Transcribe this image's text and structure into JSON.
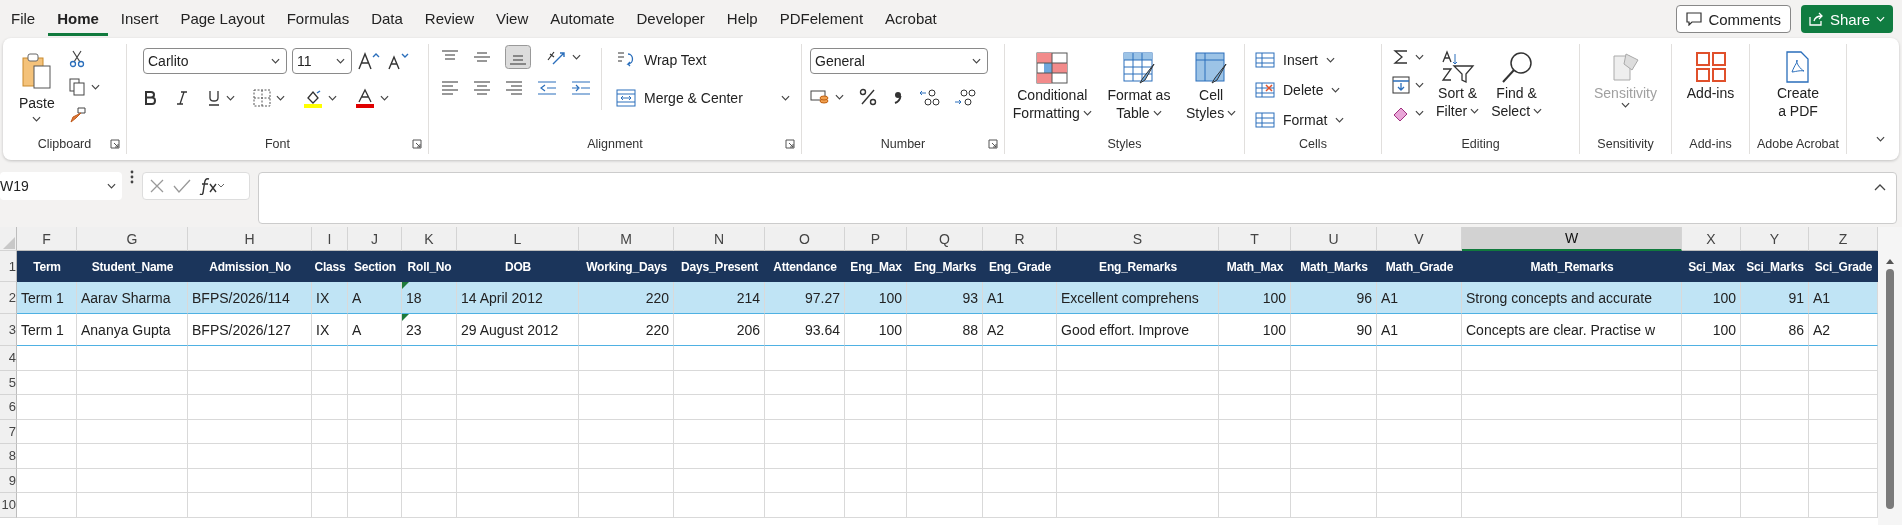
{
  "menu": {
    "tabs": [
      {
        "label": "File",
        "selected": false
      },
      {
        "label": "Home",
        "selected": true
      },
      {
        "label": "Insert",
        "selected": false
      },
      {
        "label": "Page Layout",
        "selected": false
      },
      {
        "label": "Formulas",
        "selected": false
      },
      {
        "label": "Data",
        "selected": false
      },
      {
        "label": "Review",
        "selected": false
      },
      {
        "label": "View",
        "selected": false
      },
      {
        "label": "Automate",
        "selected": false
      },
      {
        "label": "Developer",
        "selected": false
      },
      {
        "label": "Help",
        "selected": false
      },
      {
        "label": "PDFelement",
        "selected": false
      },
      {
        "label": "Acrobat",
        "selected": false
      }
    ],
    "comments": "Comments",
    "share": "Share"
  },
  "ribbon": {
    "clipboard": {
      "paste": "Paste",
      "label": "Clipboard"
    },
    "font": {
      "name": "Carlito",
      "size": "11",
      "label": "Font"
    },
    "alignment": {
      "wrap_text": "Wrap Text",
      "merge": "Merge & Center",
      "label": "Alignment"
    },
    "number": {
      "format": "General",
      "label": "Number"
    },
    "styles": {
      "buttons": [
        {
          "lines": [
            "Conditional",
            "Formatting"
          ]
        },
        {
          "lines": [
            "Format as",
            "Table"
          ]
        },
        {
          "lines": [
            "Cell",
            "Styles"
          ]
        }
      ],
      "label": "Styles"
    },
    "cells": {
      "buttons": [
        "Insert",
        "Delete",
        "Format"
      ],
      "label": "Cells"
    },
    "editing": {
      "buttons": [
        {
          "lines": [
            "Sort &",
            "Filter"
          ]
        },
        {
          "lines": [
            "Find &",
            "Select"
          ]
        }
      ],
      "label": "Editing"
    },
    "sensitivity": {
      "button": "Sensitivity",
      "disabled": true,
      "label": "Sensitivity"
    },
    "addins": {
      "button": "Add-ins",
      "label": "Add-ins"
    },
    "acrobat": {
      "lines": [
        "Create",
        "a PDF"
      ],
      "label": "Adobe Acrobat"
    }
  },
  "formula_bar": {
    "name_box": "W19"
  },
  "sheet": {
    "columns": [
      {
        "letter": "F",
        "header": "Term",
        "kind": "text",
        "selected": false
      },
      {
        "letter": "G",
        "header": "Student_Name",
        "kind": "text",
        "selected": false
      },
      {
        "letter": "H",
        "header": "Admission_No",
        "kind": "text",
        "selected": false
      },
      {
        "letter": "I",
        "header": "Class",
        "kind": "text",
        "selected": false
      },
      {
        "letter": "J",
        "header": "Section",
        "kind": "text",
        "selected": false
      },
      {
        "letter": "K",
        "header": "Roll_No",
        "kind": "text",
        "selected": false
      },
      {
        "letter": "L",
        "header": "DOB",
        "kind": "text",
        "selected": false
      },
      {
        "letter": "M",
        "header": "Working_Days",
        "kind": "number",
        "selected": false
      },
      {
        "letter": "N",
        "header": "Days_Present",
        "kind": "number",
        "selected": false
      },
      {
        "letter": "O",
        "header": "Attendance",
        "kind": "number",
        "selected": false
      },
      {
        "letter": "P",
        "header": "Eng_Max",
        "kind": "number",
        "selected": false
      },
      {
        "letter": "Q",
        "header": "Eng_Marks",
        "kind": "number",
        "selected": false
      },
      {
        "letter": "R",
        "header": "Eng_Grade",
        "kind": "text",
        "selected": false
      },
      {
        "letter": "S",
        "header": "Eng_Remarks",
        "kind": "text",
        "selected": false
      },
      {
        "letter": "T",
        "header": "Math_Max",
        "kind": "number",
        "selected": false
      },
      {
        "letter": "U",
        "header": "Math_Marks",
        "kind": "number",
        "selected": false
      },
      {
        "letter": "V",
        "header": "Math_Grade",
        "kind": "text",
        "selected": false
      },
      {
        "letter": "W",
        "header": "Math_Remarks",
        "kind": "text",
        "selected": true
      },
      {
        "letter": "X",
        "header": "Sci_Max",
        "kind": "number",
        "selected": false
      },
      {
        "letter": "Y",
        "header": "Sci_Marks",
        "kind": "number",
        "selected": false
      },
      {
        "letter": "Z",
        "header": "Sci_Grade",
        "kind": "text",
        "selected": false
      }
    ],
    "header_row": "1",
    "rows": [
      {
        "number": "2",
        "shaded": true,
        "cells": [
          {
            "text": "Term 1"
          },
          {
            "text": "Aarav Sharma"
          },
          {
            "text": "BFPS/2026/114"
          },
          {
            "text": "IX"
          },
          {
            "text": "A"
          },
          {
            "text": "18",
            "flag": true
          },
          {
            "text": "14 April 2012"
          },
          {
            "text": "220"
          },
          {
            "text": "214"
          },
          {
            "text": "97.27"
          },
          {
            "text": "100"
          },
          {
            "text": "93"
          },
          {
            "text": "A1"
          },
          {
            "text": "Excellent comprehens"
          },
          {
            "text": "100"
          },
          {
            "text": "96"
          },
          {
            "text": "A1"
          },
          {
            "text": "Strong concepts and accurate"
          },
          {
            "text": "100"
          },
          {
            "text": "91"
          },
          {
            "text": "A1"
          }
        ]
      },
      {
        "number": "3",
        "shaded": false,
        "cells": [
          {
            "text": "Term 1"
          },
          {
            "text": "Ananya Gupta"
          },
          {
            "text": "BFPS/2026/127"
          },
          {
            "text": "IX"
          },
          {
            "text": "A"
          },
          {
            "text": "23",
            "flag": true
          },
          {
            "text": "29 August 2012"
          },
          {
            "text": "220"
          },
          {
            "text": "206"
          },
          {
            "text": "93.64"
          },
          {
            "text": "100"
          },
          {
            "text": "88"
          },
          {
            "text": "A2"
          },
          {
            "text": "Good effort. Improve"
          },
          {
            "text": "100"
          },
          {
            "text": "90"
          },
          {
            "text": "A1"
          },
          {
            "text": "Concepts are clear. Practise w"
          },
          {
            "text": "100"
          },
          {
            "text": "86"
          },
          {
            "text": "A2"
          }
        ]
      }
    ],
    "empty_rows": [
      "4",
      "5",
      "6",
      "7",
      "8",
      "9",
      "10"
    ]
  }
}
